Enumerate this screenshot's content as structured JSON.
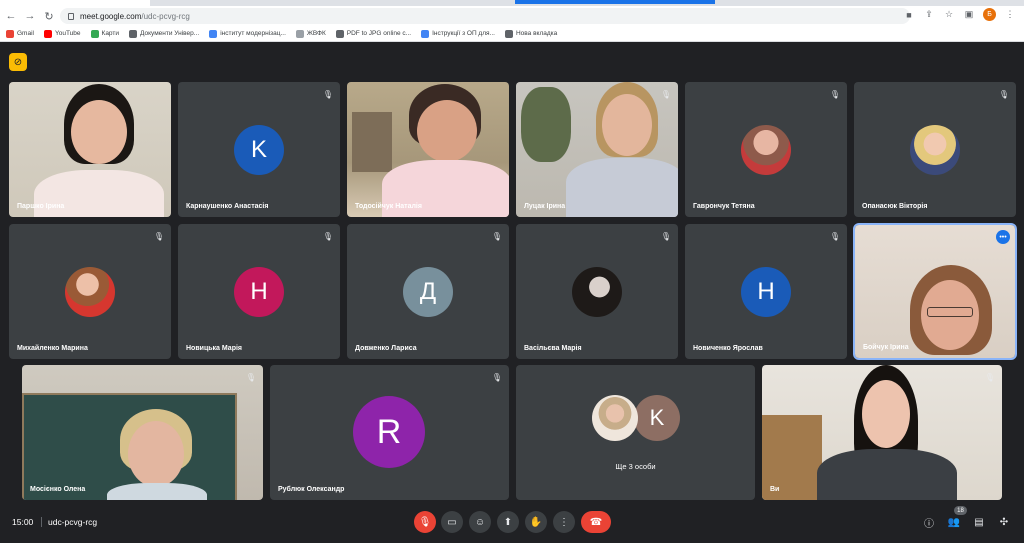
{
  "browser": {
    "url_host": "meet.google.com",
    "url_path": "/udc-pcvg-rcg",
    "profile_initial": "Б",
    "bookmarks": [
      {
        "label": "Gmail",
        "color": "#ea4335"
      },
      {
        "label": "YouTube",
        "color": "#ff0000"
      },
      {
        "label": "Карти",
        "color": "#34a853"
      },
      {
        "label": "Документи Універ...",
        "color": "#5f6368"
      },
      {
        "label": "інститут модернізац...",
        "color": "#4285f4"
      },
      {
        "label": "ЖВФК",
        "color": "#9aa0a6"
      },
      {
        "label": "PDF to JPG online c...",
        "color": "#5f6368"
      },
      {
        "label": "Інструкції з ОП для...",
        "color": "#4285f4"
      },
      {
        "label": "Нова вкладка",
        "color": "#5f6368"
      }
    ]
  },
  "participants": [
    {
      "name": "Паршко Ірина",
      "type": "video"
    },
    {
      "name": "Карнаушенко Анастасія",
      "type": "initial",
      "initial": "K",
      "color": "#1a5bb8"
    },
    {
      "name": "Тодосійчук Наталія",
      "type": "video"
    },
    {
      "name": "Луцак Ірина",
      "type": "video"
    },
    {
      "name": "Гаврончук Тетяна",
      "type": "photo"
    },
    {
      "name": "Опанасюк Вікторія",
      "type": "photo"
    },
    {
      "name": "Михайленко Марина",
      "type": "photo"
    },
    {
      "name": "Новицька Марія",
      "type": "initial",
      "initial": "Н",
      "color": "#c2185b"
    },
    {
      "name": "Довженко Лариса",
      "type": "initial",
      "initial": "Д",
      "color": "#78909c"
    },
    {
      "name": "Васільєва Марія",
      "type": "photo"
    },
    {
      "name": "Новиченко Ярослав",
      "type": "initial",
      "initial": "Н",
      "color": "#1a5bb8"
    },
    {
      "name": "Бойчук Ірина",
      "type": "video"
    },
    {
      "name": "Мосієнко Олена",
      "type": "video"
    },
    {
      "name": "Рублюк Олександр",
      "type": "initial",
      "initial": "R",
      "color": "#8e24aa"
    },
    {
      "name": "Ще 3 особи",
      "type": "group",
      "initial": "K",
      "color": "#8d6e63"
    },
    {
      "name": "Ви",
      "type": "video"
    }
  ],
  "bottom": {
    "time": "15:00",
    "meeting_code": "udc-pcvg-rcg",
    "participant_count": "18"
  }
}
